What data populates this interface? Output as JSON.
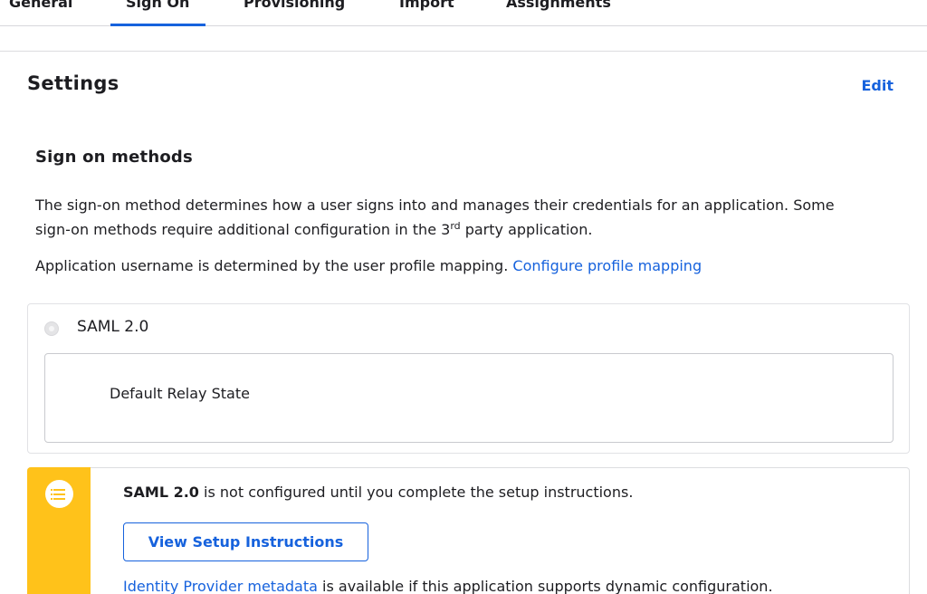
{
  "tabs": [
    {
      "label": "General"
    },
    {
      "label": "Sign On"
    },
    {
      "label": "Provisioning"
    },
    {
      "label": "Import"
    },
    {
      "label": "Assignments"
    }
  ],
  "settings": {
    "title": "Settings",
    "edit_label": "Edit"
  },
  "sign_on_methods": {
    "heading": "Sign on methods",
    "description_part1": "The sign-on method determines how a user signs into and manages their credentials for an application. Some sign-on methods require additional configuration in the 3",
    "description_sup": "rd",
    "description_part2": " party application.",
    "mapping_text": "Application username is determined by the user profile mapping.",
    "mapping_link": "Configure profile mapping"
  },
  "saml_option": {
    "label": "SAML 2.0",
    "relay_state_label": "Default Relay State"
  },
  "callout": {
    "icon": "list-icon",
    "bar_color": "#ffc21a",
    "message_bold": "SAML 2.0",
    "message_rest": "is not configured until you complete the setup instructions.",
    "button_label": "View Setup Instructions",
    "metadata_link": "Identity Provider metadata",
    "metadata_rest": "is available if this application supports dynamic configuration."
  },
  "colors": {
    "accent": "#1662dd",
    "warning": "#ffc21a"
  }
}
